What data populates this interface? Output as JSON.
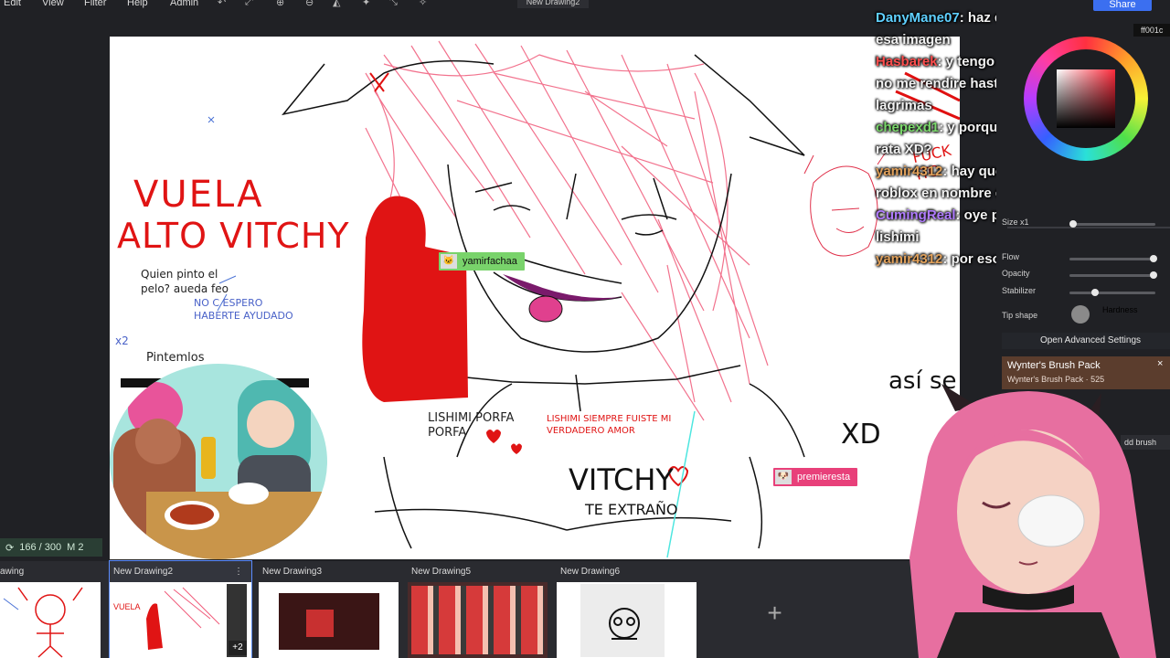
{
  "menu": {
    "items": [
      "Edit",
      "View",
      "Filter",
      "Help",
      "Admin"
    ],
    "document_title": "New Drawing2",
    "share_label": "Share",
    "hex_value": "ff001c"
  },
  "canvas": {
    "texts": {
      "vuela": "VUELA",
      "alto_vitchy": "ALTO VITCHY",
      "quien": "Quien pinto el pelo? aueda feo",
      "no_c": "NO C ESPERO HABERTE AYUDADO",
      "x2": "x2",
      "pintemlos": "Pintemlos",
      "lishimi_porfa": "LISHIMI PORFA PORFA",
      "lishimi_siempre": "LISHIMI SIEMPRE FUISTE MI VERDADERO AMOR",
      "vitchy": "VITCHY",
      "te_extrano": "TE EXTRAÑO",
      "asi_se": "así se",
      "xd": "XD",
      "puck": "FUCK ITC"
    },
    "user_tags": [
      {
        "name": "yamirfachaa",
        "color": "#79d36b"
      },
      {
        "name": "premieresta",
        "color": "#e8407a"
      }
    ]
  },
  "zoom": {
    "value": "166 / 300",
    "extra": "M 2"
  },
  "drawings": [
    {
      "label": "awing"
    },
    {
      "label": "New Drawing2",
      "badge": "+2"
    },
    {
      "label": "New Drawing3"
    },
    {
      "label": "New Drawing5"
    },
    {
      "label": "New Drawing6"
    }
  ],
  "add_drawing": "+",
  "chat": [
    {
      "user": "DanyMane07",
      "text": ": haz dejo todo su talento en esa imagen",
      "color": "#5fd0ff"
    },
    {
      "user": "Hasbarek",
      "text": ": y tengo mejores ya tew cagaste, no me rendire hasta que te vea chorreando lagrimas",
      "color": "#ff4d4d"
    },
    {
      "user": "chepexd1",
      "text": ": y porque te estas comieno una rata XD?",
      "color": "#7bd86c"
    },
    {
      "user": "yamir4312",
      "text": ": hay que hacer una ceremonia en roblox en nombre de vitchi",
      "color": "#e0a05a"
    },
    {
      "user": "CumingReal",
      "text": ": oye pq tienes esos tatuajes de lishimi",
      "color": "#b07bff"
    },
    {
      "user": "yamir4312",
      "text": ": por eso muki",
      "color": "#e0a05a"
    }
  ],
  "brush": {
    "size_label": "Size x1",
    "flow_label": "Flow",
    "opacity_label": "Opacity",
    "stabilizer_label": "Stabilizer",
    "tip_shape_label": "Tip shape",
    "hardness_label": "Hardness",
    "advanced_label": "Open Advanced Settings",
    "size": 0.04,
    "flow": 0.98,
    "opacity": 0.98,
    "stabilizer": 0.3
  },
  "brushpack": {
    "title": "Wynter's Brush Pack",
    "subtitle": "Wynter's Brush Pack · 525",
    "add": "dd brush"
  }
}
